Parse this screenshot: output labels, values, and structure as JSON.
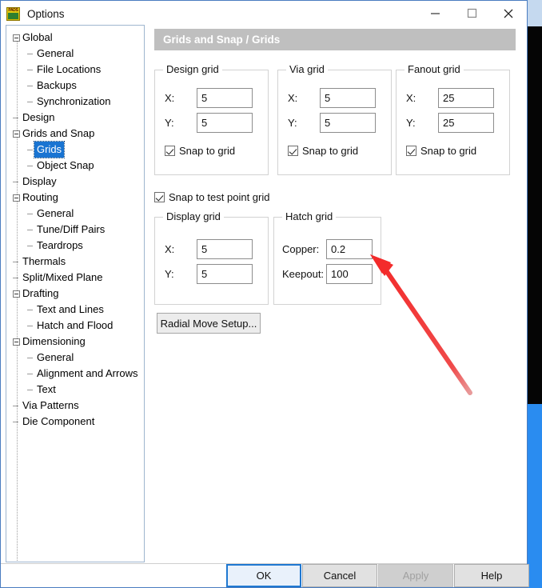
{
  "window": {
    "title": "Options",
    "icon": "pads-app-icon",
    "controls": [
      {
        "name": "minimize-button",
        "glyph": "minimize"
      },
      {
        "name": "maximize-button",
        "glyph": "maximize"
      },
      {
        "name": "close-button",
        "glyph": "close"
      }
    ]
  },
  "tree": {
    "items": [
      {
        "label": "Global",
        "level": 0,
        "expander": "minus",
        "selected": false
      },
      {
        "label": "General",
        "level": 1,
        "expander": "dash",
        "selected": false
      },
      {
        "label": "File Locations",
        "level": 1,
        "expander": "dash",
        "selected": false
      },
      {
        "label": "Backups",
        "level": 1,
        "expander": "dash",
        "selected": false
      },
      {
        "label": "Synchronization",
        "level": 1,
        "expander": "dash",
        "selected": false
      },
      {
        "label": "Design",
        "level": 0,
        "expander": "dash",
        "selected": false
      },
      {
        "label": "Grids and Snap",
        "level": 0,
        "expander": "minus",
        "selected": false
      },
      {
        "label": "Grids",
        "level": 1,
        "expander": "dash",
        "selected": true
      },
      {
        "label": "Object Snap",
        "level": 1,
        "expander": "dash",
        "selected": false
      },
      {
        "label": "Display",
        "level": 0,
        "expander": "dash",
        "selected": false
      },
      {
        "label": "Routing",
        "level": 0,
        "expander": "minus",
        "selected": false
      },
      {
        "label": "General",
        "level": 1,
        "expander": "dash",
        "selected": false
      },
      {
        "label": "Tune/Diff Pairs",
        "level": 1,
        "expander": "dash",
        "selected": false
      },
      {
        "label": "Teardrops",
        "level": 1,
        "expander": "dash",
        "selected": false
      },
      {
        "label": "Thermals",
        "level": 0,
        "expander": "dash",
        "selected": false
      },
      {
        "label": "Split/Mixed Plane",
        "level": 0,
        "expander": "dash",
        "selected": false
      },
      {
        "label": "Drafting",
        "level": 0,
        "expander": "minus",
        "selected": false
      },
      {
        "label": "Text and Lines",
        "level": 1,
        "expander": "dash",
        "selected": false
      },
      {
        "label": "Hatch and Flood",
        "level": 1,
        "expander": "dash",
        "selected": false
      },
      {
        "label": "Dimensioning",
        "level": 0,
        "expander": "minus",
        "selected": false
      },
      {
        "label": "General",
        "level": 1,
        "expander": "dash",
        "selected": false
      },
      {
        "label": "Alignment and Arrows",
        "level": 1,
        "expander": "dash",
        "selected": false
      },
      {
        "label": "Text",
        "level": 1,
        "expander": "dash",
        "selected": false
      },
      {
        "label": "Via Patterns",
        "level": 0,
        "expander": "dash",
        "selected": false
      },
      {
        "label": "Die Component",
        "level": 0,
        "expander": "dash",
        "selected": false
      }
    ]
  },
  "page": {
    "header": "Grids and Snap / Grids",
    "design_grid": {
      "title": "Design grid",
      "x_label": "X:",
      "x_value": "5",
      "y_label": "Y:",
      "y_value": "5",
      "snap_label": "Snap to grid",
      "snap_checked": true
    },
    "via_grid": {
      "title": "Via grid",
      "x_label": "X:",
      "x_value": "5",
      "y_label": "Y:",
      "y_value": "5",
      "snap_label": "Snap to grid",
      "snap_checked": true
    },
    "fanout_grid": {
      "title": "Fanout grid",
      "x_label": "X:",
      "x_value": "25",
      "y_label": "Y:",
      "y_value": "25",
      "snap_label": "Snap to grid",
      "snap_checked": true
    },
    "snap_test_point": {
      "label": "Snap to test point grid",
      "checked": true
    },
    "display_grid": {
      "title": "Display grid",
      "x_label": "X:",
      "x_value": "5",
      "y_label": "Y:",
      "y_value": "5"
    },
    "hatch_grid": {
      "title": "Hatch grid",
      "copper_label": "Copper:",
      "copper_value": "0.2",
      "keepout_label": "Keepout:",
      "keepout_value": "100"
    },
    "radial_move_button": "Radial Move Setup..."
  },
  "footer": {
    "ok": "OK",
    "cancel": "Cancel",
    "apply": "Apply",
    "help": "Help"
  },
  "annotation": {
    "type": "red-arrow",
    "color": "#f03030",
    "points_to": "hatch-grid-copper-input"
  }
}
